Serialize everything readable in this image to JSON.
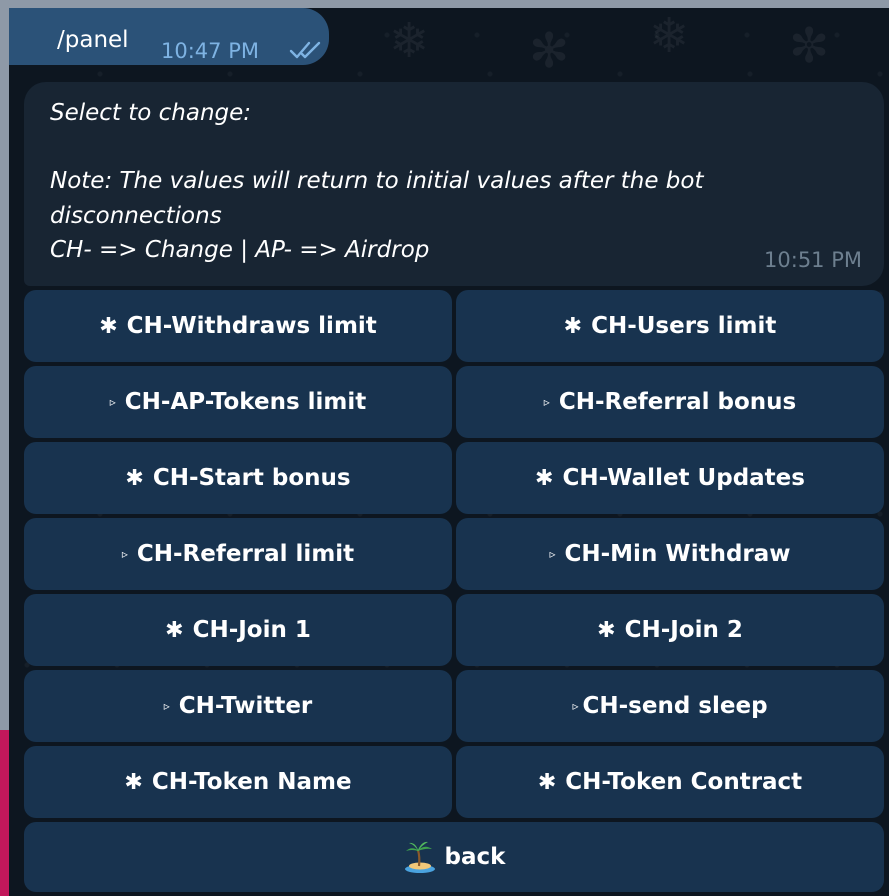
{
  "outgoing_message": {
    "text": "/panel",
    "time": "10:47 PM",
    "status": "read",
    "status_icon": "double-check-icon"
  },
  "incoming_message": {
    "lines": [
      "Select to change:",
      "",
      "Note: The values will return to initial values after the bot",
      "disconnections",
      "CH- => Change | AP- => Airdrop"
    ],
    "time": "10:51 PM"
  },
  "keyboard": {
    "rows": [
      [
        {
          "icon": "✱",
          "icon_name": "asterisk-icon",
          "label": "CH-Withdraws limit"
        },
        {
          "icon": "✱",
          "icon_name": "asterisk-icon",
          "label": "CH-Users limit"
        }
      ],
      [
        {
          "icon": "▹",
          "icon_name": "triangle-right-icon",
          "label": "CH-AP-Tokens limit"
        },
        {
          "icon": "▹",
          "icon_name": "triangle-right-icon",
          "label": "CH-Referral bonus"
        }
      ],
      [
        {
          "icon": "✱",
          "icon_name": "asterisk-icon",
          "label": "CH-Start bonus"
        },
        {
          "icon": "✱",
          "icon_name": "asterisk-icon",
          "label": "CH-Wallet Updates"
        }
      ],
      [
        {
          "icon": "▹",
          "icon_name": "triangle-right-icon",
          "label": "CH-Referral limit"
        },
        {
          "icon": "▹",
          "icon_name": "triangle-right-icon",
          "label": "CH-Min Withdraw"
        }
      ],
      [
        {
          "icon": "✱",
          "icon_name": "asterisk-icon",
          "label": "CH-Join 1"
        },
        {
          "icon": "✱",
          "icon_name": "asterisk-icon",
          "label": "CH-Join 2"
        }
      ],
      [
        {
          "icon": "▹",
          "icon_name": "triangle-right-icon",
          "label": "CH-Twitter"
        },
        {
          "icon": "▹",
          "icon_name": "triangle-right-icon",
          "label": "CH-send sleep"
        }
      ],
      [
        {
          "icon": "✱",
          "icon_name": "asterisk-icon",
          "label": "CH-Token Name"
        },
        {
          "icon": "✱",
          "icon_name": "asterisk-icon",
          "label": "CH-Token Contract"
        }
      ]
    ],
    "back": {
      "icon_name": "desert-island-icon",
      "label": "back"
    }
  },
  "colors": {
    "chat_background": "#0d1620",
    "outgoing_bubble": "#2b5278",
    "incoming_bubble": "#182533",
    "keyboard_button": "#18334f",
    "time_outgoing": "#7eb3e3",
    "time_incoming": "#6d7f8f"
  }
}
